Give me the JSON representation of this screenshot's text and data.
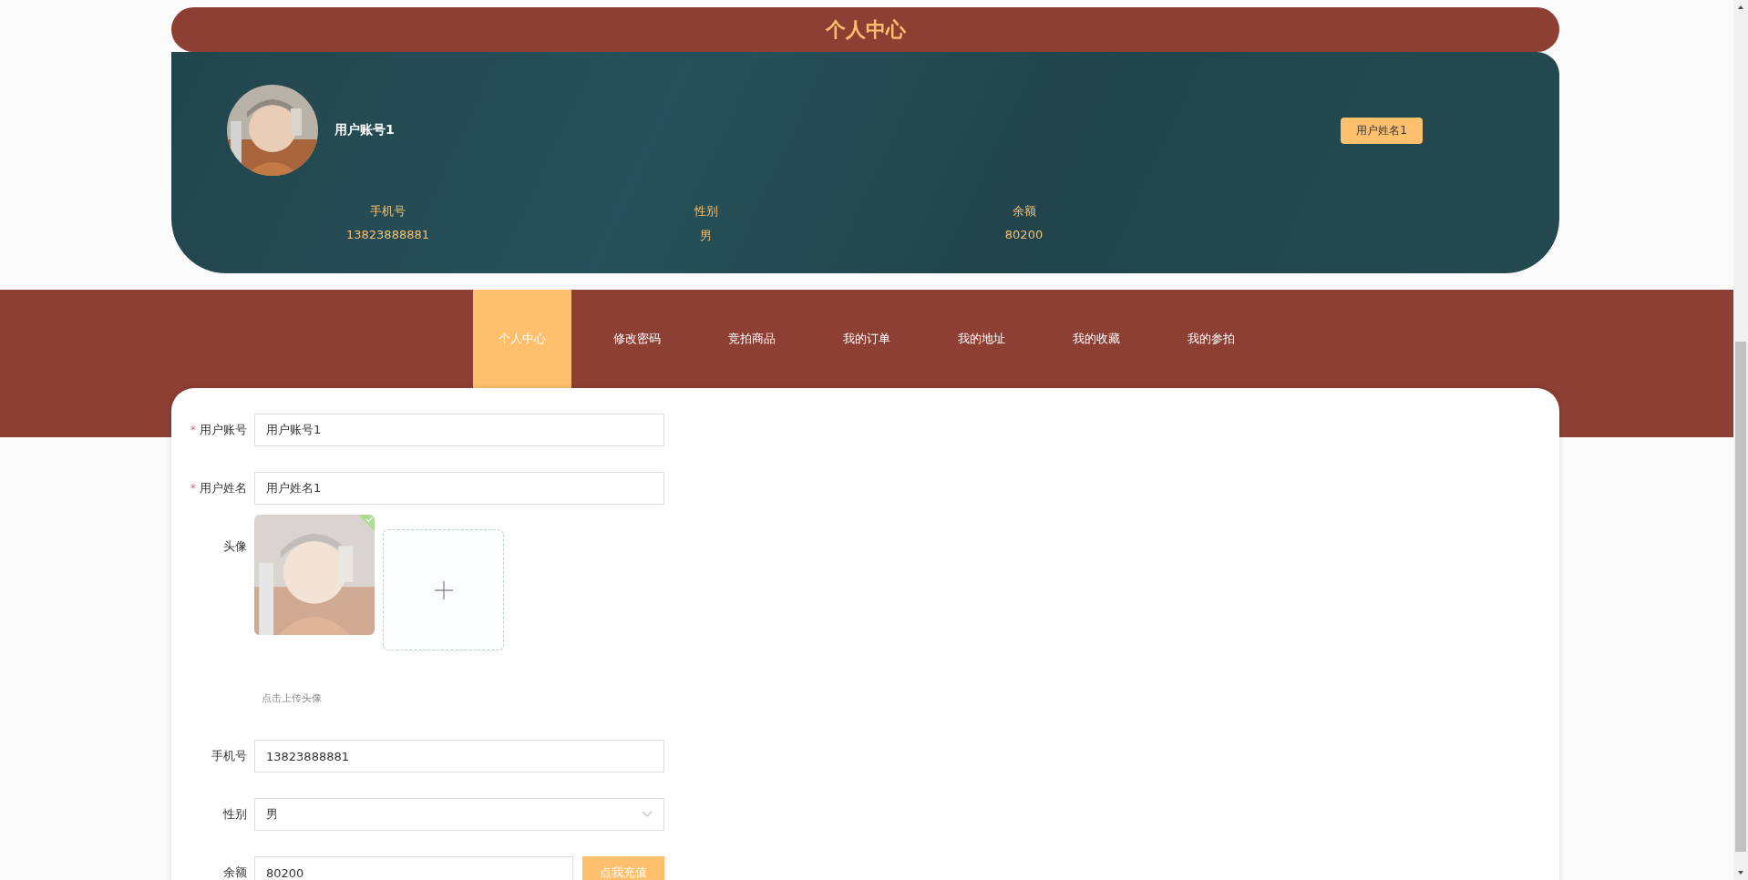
{
  "header": {
    "title": "个人中心"
  },
  "profile": {
    "account": "用户账号1",
    "name_badge": "用户姓名1",
    "stats": [
      {
        "label": "手机号",
        "value": "13823888881"
      },
      {
        "label": "性别",
        "value": "男"
      },
      {
        "label": "余额",
        "value": "80200"
      }
    ]
  },
  "nav": {
    "tabs": [
      {
        "label": "个人中心",
        "selected": true
      },
      {
        "label": "修改密码",
        "selected": false
      },
      {
        "label": "竞拍商品",
        "selected": false
      },
      {
        "label": "我的订单",
        "selected": false
      },
      {
        "label": "我的地址",
        "selected": false
      },
      {
        "label": "我的收藏",
        "selected": false
      },
      {
        "label": "我的参拍",
        "selected": false
      }
    ]
  },
  "form": {
    "required_mark": "*",
    "fields": [
      {
        "kind": "input",
        "label": "用户账号",
        "required": true,
        "value": "用户账号1"
      },
      {
        "kind": "input",
        "label": "用户姓名",
        "required": true,
        "value": "用户姓名1"
      },
      {
        "label": "头像",
        "required": false,
        "hint": "点击上传头像"
      },
      {
        "kind": "input",
        "label": "手机号",
        "required": false,
        "value": "13823888881"
      },
      {
        "kind": "select",
        "label": "性别",
        "required": false,
        "value": "男"
      },
      {
        "kind": "action",
        "label": "余额",
        "required": false,
        "value": "80200",
        "button": "点我充值"
      }
    ]
  }
}
